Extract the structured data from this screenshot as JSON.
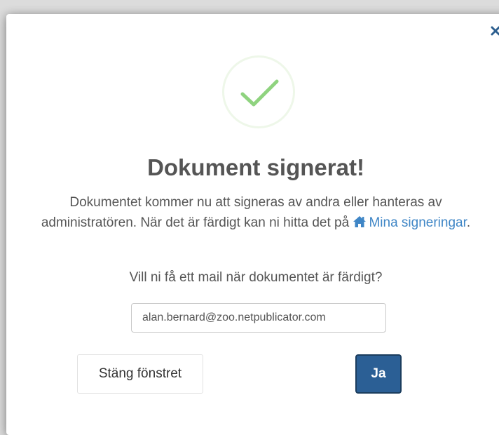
{
  "dialog": {
    "title": "Dokument signerat!",
    "message_part1": "Dokumentet kommer nu att signeras av andra eller hanteras av administratören. När det är färdigt kan ni hitta det på",
    "link_label": "Mina signeringar",
    "message_end": ".",
    "link_icon": "home-icon",
    "question": "Vill ni få ett mail när dokumentet är färdigt?",
    "close_icon": "close-icon",
    "status_icon": "checkmark-icon"
  },
  "email": {
    "value": "alan.bernard@zoo.netpublicator.com"
  },
  "buttons": {
    "close_label": "Stäng fönstret",
    "yes_label": "Ja"
  },
  "colors": {
    "accent": "#3f86c6",
    "primary_button": "#2b5f95",
    "success": "#8fd37f",
    "text": "#555555"
  }
}
